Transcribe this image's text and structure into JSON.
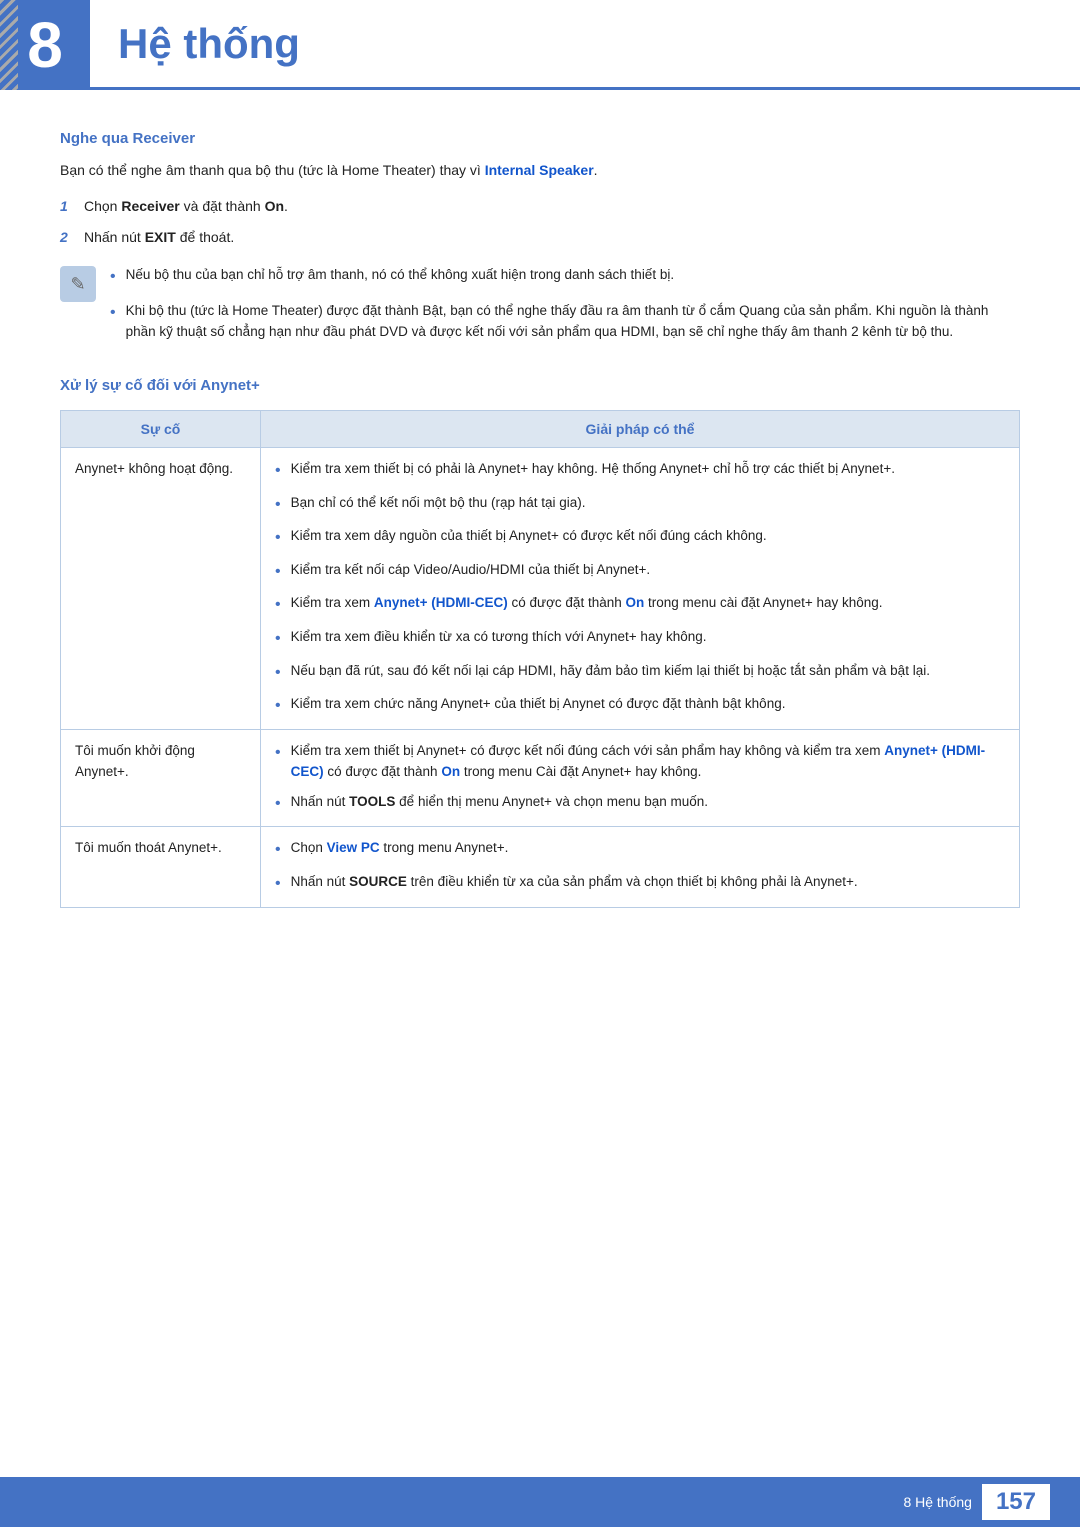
{
  "header": {
    "chapter_number": "8",
    "chapter_title": "Hệ thống"
  },
  "section1": {
    "title": "Nghe qua Receiver",
    "intro": "Bạn có thể nghe âm thanh qua bộ thu (tức là Home Theater) thay vì ",
    "intro_bold": "Internal Speaker",
    "intro_end": ".",
    "steps": [
      {
        "num": "1",
        "prefix": "Chọn ",
        "bold": "Receiver",
        "suffix": " và đặt thành ",
        "bold2": "On",
        "end": "."
      },
      {
        "num": "2",
        "prefix": "Nhấn nút ",
        "bold": "EXIT",
        "suffix": " để thoát."
      }
    ],
    "notes": [
      "Nếu bộ thu của bạn chỉ hỗ trợ âm thanh, nó có thể không xuất hiện trong danh sách thiết bị.",
      "Khi bộ thu (tức là Home Theater) được đặt thành Bật, bạn có thể nghe thấy đầu ra âm thanh từ ổ cắm Quang của sản phẩm. Khi nguồn là thành phần kỹ thuật số chẳng hạn như đầu phát DVD và được kết nối với sản phẩm qua HDMI, bạn sẽ chỉ nghe thấy âm thanh 2 kênh từ bộ thu."
    ]
  },
  "section2": {
    "title": "Xử lý sự cố đối với Anynet+",
    "table": {
      "col1_header": "Sự cố",
      "col2_header": "Giải pháp có thể",
      "rows": [
        {
          "issue": "Anynet+ không hoạt động.",
          "solutions": [
            "Kiểm tra xem thiết bị có phải là Anynet+ hay không. Hệ thống Anynet+ chỉ hỗ trợ các thiết bị Anynet+.",
            "Bạn chỉ có thể kết nối một bộ thu (rạp hát tại gia).",
            "Kiểm tra xem dây nguồn của thiết bị Anynet+ có được kết nối đúng cách không.",
            "Kiểm tra kết nối cáp Video/Audio/HDMI của thiết bị Anynet+.",
            {
              "prefix": "Kiểm tra xem ",
              "bold": "Anynet+ (HDMI-CEC)",
              "middle": " có được đặt thành ",
              "bold2": "On",
              "suffix": " trong menu cài đặt Anynet+ hay không."
            },
            "Kiểm tra xem điều khiển từ xa có tương thích với Anynet+ hay không.",
            "Nếu bạn đã rút, sau đó kết nối lại cáp HDMI, hãy đảm bảo tìm kiếm lại thiết bị hoặc tắt sản phẩm và bật lại.",
            "Kiểm tra xem chức năng Anynet+ của thiết bị Anynet có được đặt thành bật không."
          ]
        },
        {
          "issue": "Tôi muốn khởi động Anynet+.",
          "solutions": [
            {
              "prefix": "Kiểm tra xem thiết bị Anynet+ có được kết nối đúng cách với sản phẩm hay không và kiểm tra xem ",
              "bold": "Anynet+ (HDMI-CEC)",
              "middle": " có được đặt thành ",
              "bold2": "On",
              "suffix": " trong menu Cài đặt Anynet+ hay không."
            },
            {
              "prefix": "Nhấn nút ",
              "bold": "TOOLS",
              "suffix": " để hiển thị menu Anynet+ và chọn menu bạn muốn."
            }
          ]
        },
        {
          "issue": "Tôi muốn thoát Anynet+.",
          "solutions": [
            {
              "prefix": "Chọn ",
              "bold": "View PC",
              "suffix": " trong menu Anynet+."
            },
            {
              "prefix": "Nhấn nút ",
              "bold": "SOURCE",
              "suffix": " trên điều khiển từ xa của sản phẩm và chọn thiết bị không phải là Anynet+."
            }
          ]
        }
      ]
    }
  },
  "footer": {
    "text": "8 Hệ thống",
    "page": "157"
  }
}
